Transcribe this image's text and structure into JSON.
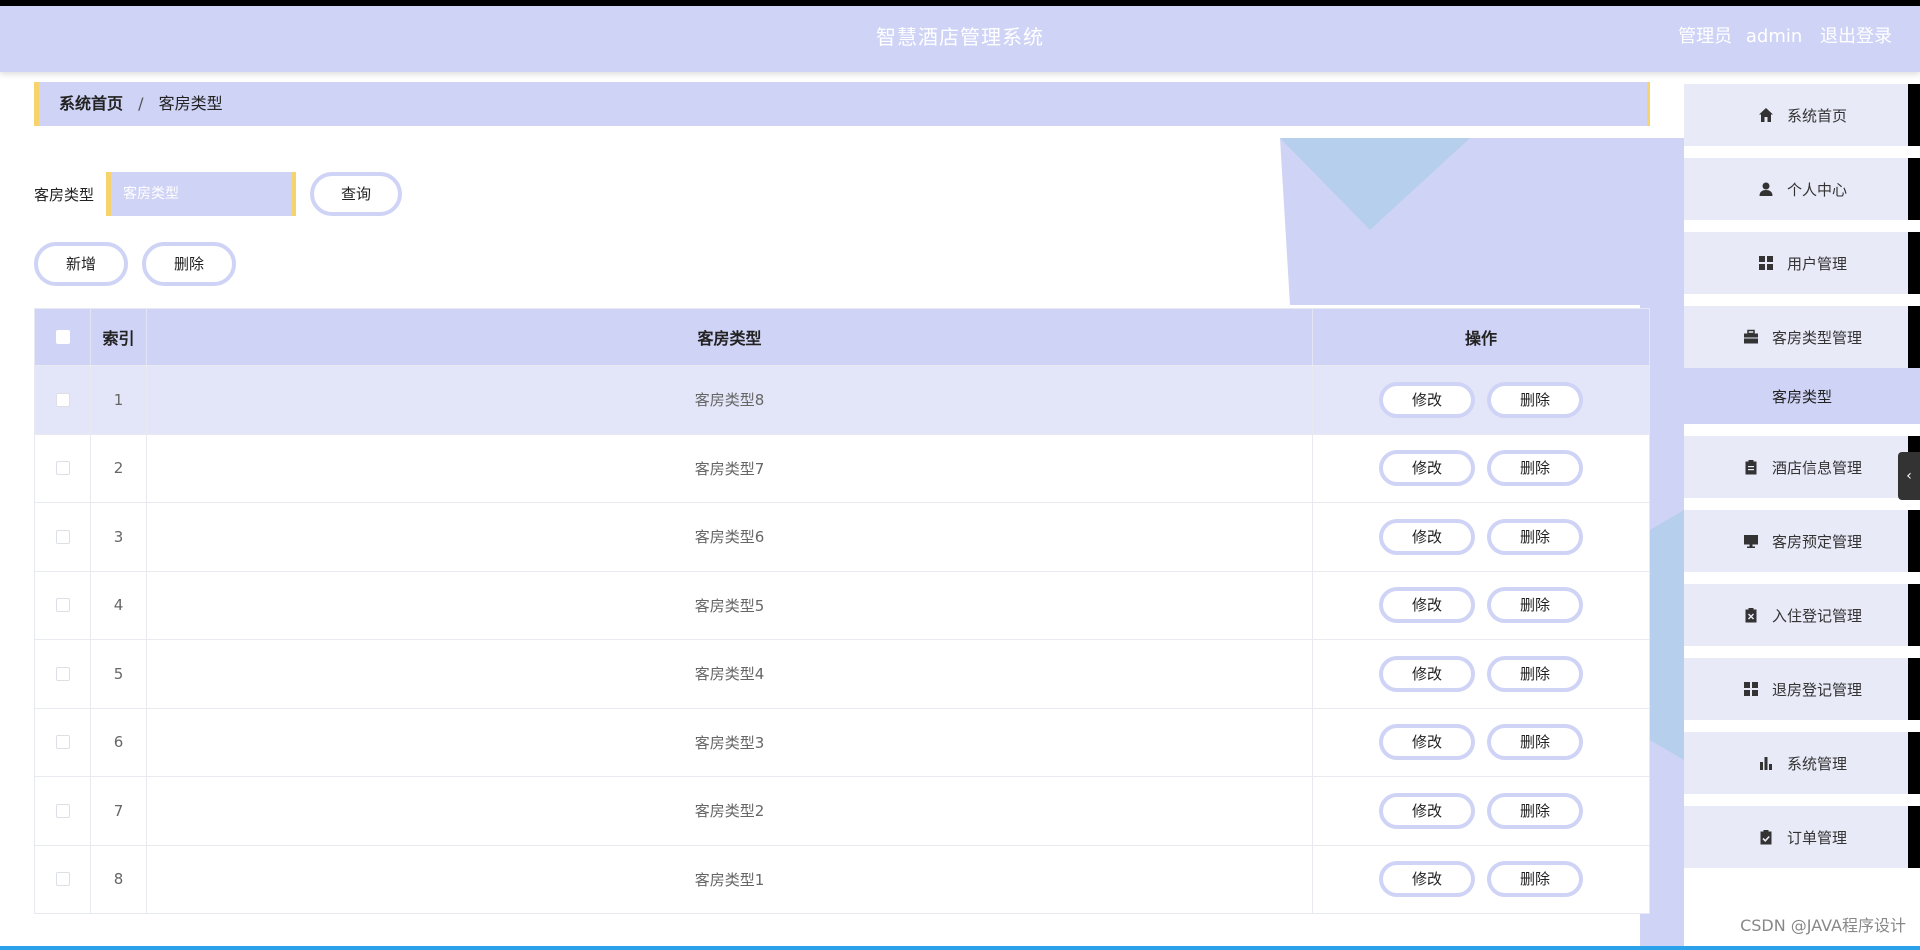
{
  "header": {
    "title": "智慧酒店管理系统",
    "role": "管理员",
    "username": "admin",
    "logout": "退出登录"
  },
  "breadcrumb": {
    "home": "系统首页",
    "separator": "/",
    "current": "客房类型"
  },
  "search": {
    "label": "客房类型",
    "placeholder": "客房类型",
    "value": "",
    "button": "查询"
  },
  "actions": {
    "add": "新增",
    "delete": "删除"
  },
  "table": {
    "columns": {
      "index": "索引",
      "type": "客房类型",
      "operation": "操作"
    },
    "edit_label": "修改",
    "delete_label": "删除",
    "rows": [
      {
        "index": "1",
        "type": "客房类型8"
      },
      {
        "index": "2",
        "type": "客房类型7"
      },
      {
        "index": "3",
        "type": "客房类型6"
      },
      {
        "index": "4",
        "type": "客房类型5"
      },
      {
        "index": "5",
        "type": "客房类型4"
      },
      {
        "index": "6",
        "type": "客房类型3"
      },
      {
        "index": "7",
        "type": "客房类型2"
      },
      {
        "index": "8",
        "type": "客房类型1"
      }
    ]
  },
  "sidebar": {
    "items": [
      {
        "label": "系统首页",
        "icon": "home-icon"
      },
      {
        "label": "个人中心",
        "icon": "user-icon"
      },
      {
        "label": "用户管理",
        "icon": "grid-icon"
      },
      {
        "label": "客房类型管理",
        "icon": "briefcase-icon"
      },
      {
        "label": "酒店信息管理",
        "icon": "clipboard-icon"
      },
      {
        "label": "客房预定管理",
        "icon": "monitor-icon"
      },
      {
        "label": "入住登记管理",
        "icon": "clipboard-x-icon"
      },
      {
        "label": "退房登记管理",
        "icon": "grid-icon"
      },
      {
        "label": "系统管理",
        "icon": "bar-chart-icon"
      },
      {
        "label": "订单管理",
        "icon": "clipboard-check-icon"
      }
    ],
    "sub_item": "客房类型"
  },
  "watermark": "CSDN @JAVA程序设计",
  "colors": {
    "primary": "#cfd3f5",
    "accent": "#f6d36c",
    "decoration": "#b5cfec"
  }
}
